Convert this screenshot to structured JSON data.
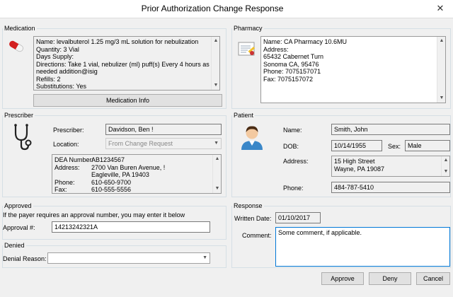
{
  "window": {
    "title": "Prior Authorization Change Response"
  },
  "medication": {
    "group_label": "Medication",
    "lines": [
      "Name: levalbuterol 1.25 mg/3 mL solution for nebulization",
      "Quantity: 3 Vial",
      "Days Supply:",
      "Directions: Take 1 vial, nebulizer (ml) puff(s) Every 4 hours as",
      "needed addition@isig",
      "Refills: 2",
      "Substitutions: Yes"
    ],
    "info_button": "Medication Info",
    "icon": "pill-capsule-icon"
  },
  "pharmacy": {
    "group_label": "Pharmacy",
    "lines": [
      "Name: CA Pharmacy 10.6MU",
      "Address:",
      "65432 Cabernet Turn",
      "Sonoma CA, 95476",
      "Phone: 7075157071",
      "Fax: 7075157072"
    ],
    "icon": "prescription-pad-icon"
  },
  "prescriber": {
    "group_label": "Prescriber",
    "prescriber_label": "Prescriber:",
    "prescriber_value": "Davidson, Ben !",
    "location_label": "Location:",
    "location_value": "From Change Request",
    "details": [
      {
        "key": "DEA Number:",
        "value": "AB1234567"
      },
      {
        "key": "Address:",
        "value": "2700 Van Buren Avenue, !"
      },
      {
        "key": "",
        "value": "Eagleville, PA 19403"
      },
      {
        "key": "Phone:",
        "value": "610-650-9700"
      },
      {
        "key": "Fax:",
        "value": "610-555-5556"
      }
    ],
    "icon": "stethoscope-icon"
  },
  "patient": {
    "group_label": "Patient",
    "name_label": "Name:",
    "name_value": "Smith, John",
    "dob_label": "DOB:",
    "dob_value": "10/14/1955",
    "sex_label": "Sex:",
    "sex_value": "Male",
    "address_label": "Address:",
    "address_lines": [
      "15 High Street",
      "Wayne, PA 19087"
    ],
    "phone_label": "Phone:",
    "phone_value": "484-787-5410",
    "icon": "person-avatar-icon"
  },
  "approved": {
    "group_label": "Approved",
    "hint": "If the payer requires an approval number, you may enter it below",
    "approval_label": "Approval #:",
    "approval_value": "14213242321A"
  },
  "denied": {
    "group_label": "Denied",
    "reason_label": "Denial Reason:",
    "reason_value": ""
  },
  "response": {
    "group_label": "Response",
    "written_date_label": "Written Date:",
    "written_date_value": "01/10/2017",
    "comment_label": "Comment:",
    "comment_value": "Some comment, if applicable."
  },
  "buttons": {
    "approve": "Approve",
    "deny": "Deny",
    "cancel": "Cancel"
  },
  "colors": {
    "accent": "#0078d7",
    "background": "#f0f0f0"
  }
}
